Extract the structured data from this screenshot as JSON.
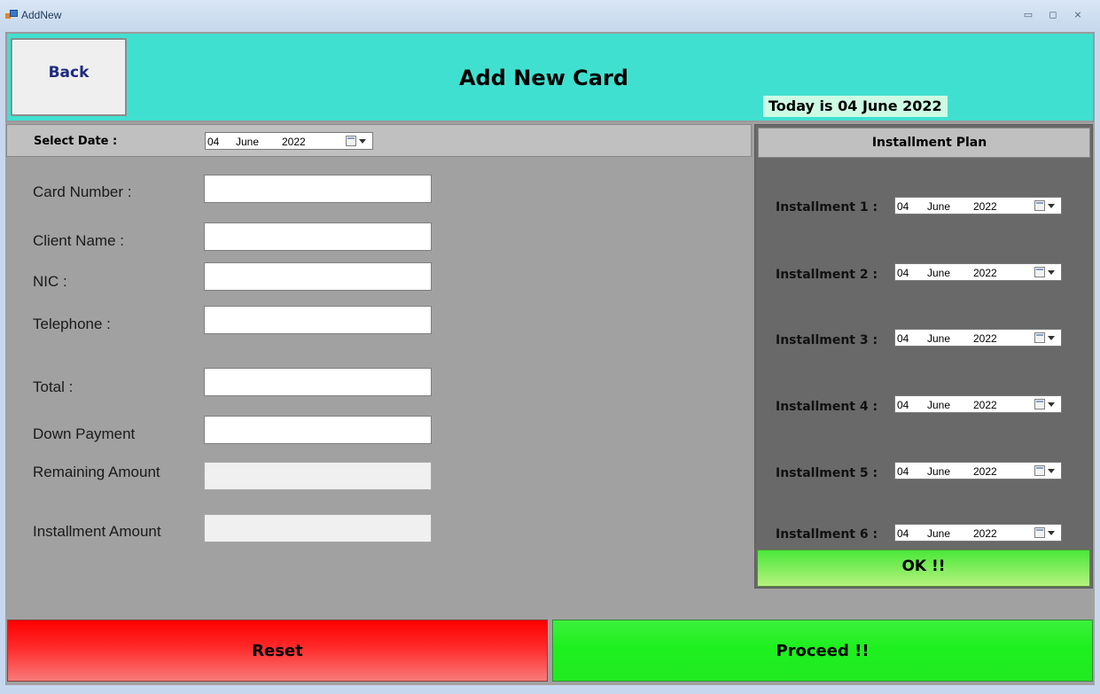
{
  "window": {
    "title": "AddNew",
    "controls": {
      "minimize": "▭",
      "maximize": "◻",
      "close": "⨯"
    }
  },
  "header": {
    "back_label": "Back",
    "title": "Add New Card",
    "today": "Today is  04 June 2022",
    "bg_color": "#40e0d0"
  },
  "select_date": {
    "label": "Select Date :",
    "day": "04",
    "month": "June",
    "year": "2022"
  },
  "form": {
    "card_number": {
      "label": "Card Number :",
      "value": ""
    },
    "client_name": {
      "label": "Client Name :",
      "value": ""
    },
    "nic": {
      "label": "NIC :",
      "value": ""
    },
    "telephone": {
      "label": "Telephone :",
      "value": ""
    },
    "total": {
      "label": "Total :",
      "value": ""
    },
    "down_payment": {
      "label": "Down Payment",
      "value": ""
    },
    "remaining_amount": {
      "label": "Remaining Amount",
      "value": ""
    },
    "installment_amount": {
      "label": "Installment Amount",
      "value": ""
    }
  },
  "installment_plan": {
    "title": "Installment  Plan",
    "items": [
      {
        "label": "Installment 1 :",
        "day": "04",
        "month": "June",
        "year": "2022"
      },
      {
        "label": "Installment 2 :",
        "day": "04",
        "month": "June",
        "year": "2022"
      },
      {
        "label": "Installment 3 :",
        "day": "04",
        "month": "June",
        "year": "2022"
      },
      {
        "label": "Installment 4 :",
        "day": "04",
        "month": "June",
        "year": "2022"
      },
      {
        "label": "Installment 5 :",
        "day": "04",
        "month": "June",
        "year": "2022"
      },
      {
        "label": "Installment 6 :",
        "day": "04",
        "month": "June",
        "year": "2022"
      }
    ],
    "ok_label": "OK !!"
  },
  "footer": {
    "reset_label": "Reset",
    "proceed_label": "Proceed !!"
  },
  "icons": [
    "app-icon",
    "calendar-dropdown-icon",
    "minimize-icon",
    "maximize-icon",
    "close-icon"
  ]
}
